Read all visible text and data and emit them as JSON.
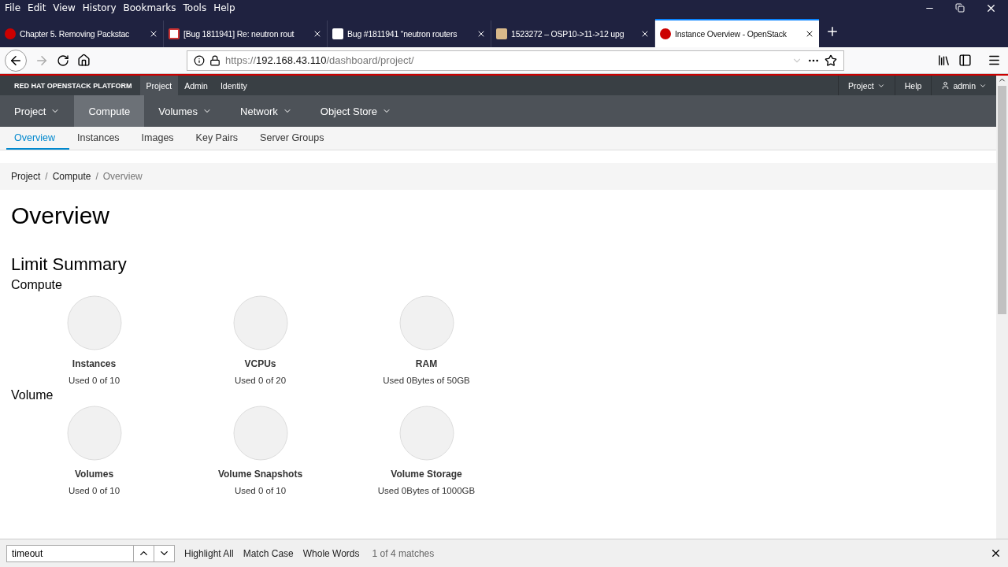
{
  "menu_bar": [
    "File",
    "Edit",
    "View",
    "History",
    "Bookmarks",
    "Tools",
    "Help"
  ],
  "tabs": [
    {
      "title": "Chapter 5. Removing Packstac",
      "selected": false
    },
    {
      "title": "[Bug 1811941] Re: neutron rout",
      "selected": false
    },
    {
      "title": "Bug #1811941 “neutron routers",
      "selected": false
    },
    {
      "title": "1523272 – OSP10->11->12 upg",
      "selected": false
    },
    {
      "title": "Instance Overview - OpenStack",
      "selected": true
    }
  ],
  "address_bar": {
    "scheme": "https://",
    "host": "192.168.43.110",
    "path": "/dashboard/project/"
  },
  "top_nav": {
    "brand": "RED HAT OPENSTACK PLATFORM",
    "items": [
      {
        "label": "Project",
        "selected": true
      },
      {
        "label": "Admin",
        "selected": false
      },
      {
        "label": "Identity",
        "selected": false
      }
    ],
    "right": [
      {
        "label": "Project",
        "dropdown": true,
        "kind": "text"
      },
      {
        "label": "Help",
        "dropdown": false,
        "kind": "text"
      },
      {
        "label": "admin",
        "dropdown": true,
        "kind": "user"
      }
    ]
  },
  "section_nav": [
    {
      "label": "Project",
      "dropdown": true,
      "selected": false
    },
    {
      "label": "Compute",
      "dropdown": false,
      "selected": true
    },
    {
      "label": "Volumes",
      "dropdown": true,
      "selected": false
    },
    {
      "label": "Network",
      "dropdown": true,
      "selected": false
    },
    {
      "label": "Object Store",
      "dropdown": true,
      "selected": false
    }
  ],
  "sub_nav": [
    {
      "label": "Overview",
      "selected": true
    },
    {
      "label": "Instances",
      "selected": false
    },
    {
      "label": "Images",
      "selected": false
    },
    {
      "label": "Key Pairs",
      "selected": false
    },
    {
      "label": "Server Groups",
      "selected": false
    }
  ],
  "breadcrumb": [
    {
      "label": "Project",
      "separator": "/"
    },
    {
      "label": "Compute",
      "separator": "/"
    },
    {
      "label": "Overview"
    }
  ],
  "page_title": "Overview",
  "limit_summary": {
    "title": "Limit Summary",
    "groups": [
      {
        "title": "Compute",
        "items": [
          {
            "name": "Instances",
            "usage": "Used 0 of 10"
          },
          {
            "name": "VCPUs",
            "usage": "Used 0 of 20"
          },
          {
            "name": "RAM",
            "usage": "Used 0Bytes of 50GB"
          }
        ]
      },
      {
        "title": "Volume",
        "items": [
          {
            "name": "Volumes",
            "usage": "Used 0 of 10"
          },
          {
            "name": "Volume Snapshots",
            "usage": "Used 0 of 10"
          },
          {
            "name": "Volume Storage",
            "usage": "Used 0Bytes of 1000GB"
          }
        ]
      }
    ]
  },
  "find_bar": {
    "value": "timeout",
    "options": [
      "Highlight All",
      "Match Case",
      "Whole Words"
    ],
    "result": "1 of 4 matches"
  }
}
